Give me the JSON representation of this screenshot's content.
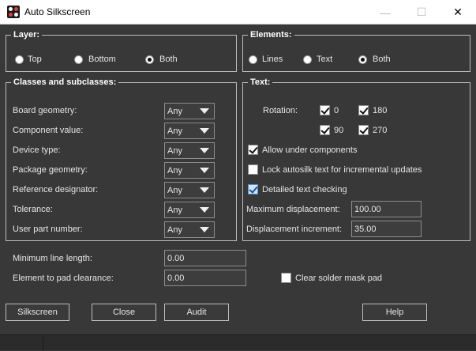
{
  "window": {
    "title": "Auto Silkscreen",
    "icon": "app-icon",
    "minimize_glyph": "—",
    "maximize_glyph": "☐",
    "close_glyph": "✕"
  },
  "layer": {
    "label": "Layer:",
    "options": [
      "Top",
      "Bottom",
      "Both"
    ],
    "selected": "Both"
  },
  "elements": {
    "label": "Elements:",
    "options": [
      "Lines",
      "Text",
      "Both"
    ],
    "selected": "Both"
  },
  "classes": {
    "label": "Classes and subclasses:",
    "rows": [
      {
        "label": "Board geometry:",
        "value": "Any"
      },
      {
        "label": "Component value:",
        "value": "Any"
      },
      {
        "label": "Device type:",
        "value": "Any"
      },
      {
        "label": "Package geometry:",
        "value": "Any"
      },
      {
        "label": "Reference designator:",
        "value": "Any"
      },
      {
        "label": "Tolerance:",
        "value": "Any"
      },
      {
        "label": "User part number:",
        "value": "Any"
      }
    ]
  },
  "text_group": {
    "label": "Text:",
    "rotation_label": "Rotation:",
    "rotations": [
      {
        "label": "0",
        "checked": true
      },
      {
        "label": "180",
        "checked": true
      },
      {
        "label": "90",
        "checked": true
      },
      {
        "label": "270",
        "checked": true
      }
    ],
    "allow_under_components": {
      "label": "Allow under components",
      "checked": true
    },
    "lock_autosilk": {
      "label": "Lock autosilk text for incremental updates",
      "checked": false
    },
    "detailed_text_checking": {
      "label": "Detailed text checking",
      "checked": true
    },
    "max_displacement": {
      "label": "Maximum displacement:",
      "value": "100.00"
    },
    "displacement_increment": {
      "label": "Displacement increment:",
      "value": "35.00"
    }
  },
  "bottom": {
    "min_line_length": {
      "label": "Minimum line length:",
      "value": "0.00"
    },
    "element_to_pad": {
      "label": "Element to pad clearance:",
      "value": "0.00"
    },
    "clear_solder_mask": {
      "label": "Clear solder mask pad",
      "checked": false
    }
  },
  "buttons": {
    "silkscreen": "Silkscreen",
    "close": "Close",
    "audit": "Audit",
    "help": "Help"
  },
  "colors": {
    "background": "#383838",
    "titlebar": "#ffffff",
    "border": "#bdbdbd"
  }
}
